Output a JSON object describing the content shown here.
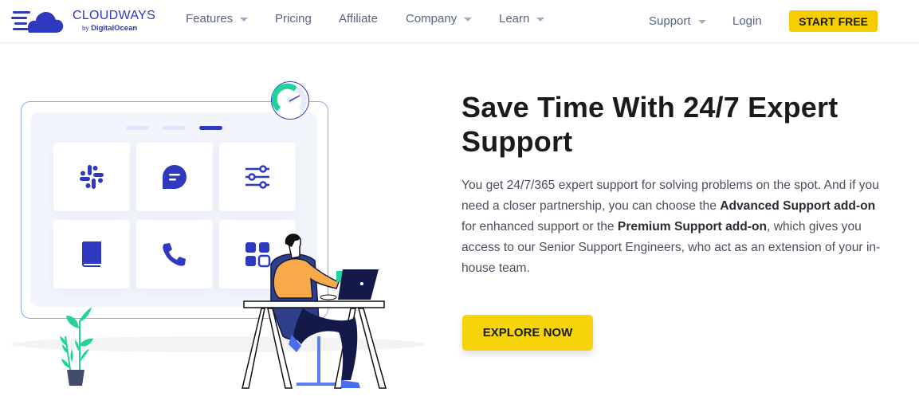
{
  "brand": {
    "name": "CLOUDWAYS",
    "sub_by": "by",
    "sub_name": "DigitalOcean",
    "color": "#2f39bf"
  },
  "nav": {
    "items": [
      {
        "label": "Features",
        "dropdown": true
      },
      {
        "label": "Pricing",
        "dropdown": false
      },
      {
        "label": "Affiliate",
        "dropdown": false
      },
      {
        "label": "Company",
        "dropdown": true
      },
      {
        "label": "Learn",
        "dropdown": true
      }
    ],
    "right": {
      "support": "Support",
      "login": "Login",
      "cta": "START FREE"
    }
  },
  "hero": {
    "title": "Save Time With 24/7 Expert Support",
    "paragraph": {
      "part1": "You get 24/7/365 expert support for solving problems on the spot. And if you need a closer partnership, you can choose the ",
      "bold1": "Advanced Support add-on",
      "part2": " for enhanced support or the ",
      "bold2": "Premium Support add-on",
      "part3": ", which gives you access to our Senior Support Engineers, who act as an extension of your in-house team."
    },
    "cta": "EXPLORE NOW"
  },
  "illustration": {
    "tiles": [
      {
        "icon": "slack-icon"
      },
      {
        "icon": "chat-bubble-icon"
      },
      {
        "icon": "sliders-icon"
      },
      {
        "icon": "book-icon"
      },
      {
        "icon": "phone-icon"
      },
      {
        "icon": "apps-grid-icon"
      }
    ],
    "carousel_active_index": 2,
    "colors": {
      "accent": "#2f39bf",
      "green": "#1fd39a",
      "yellow": "#f6cd00",
      "orange": "#f8a94a",
      "navy": "#131a4a"
    }
  }
}
